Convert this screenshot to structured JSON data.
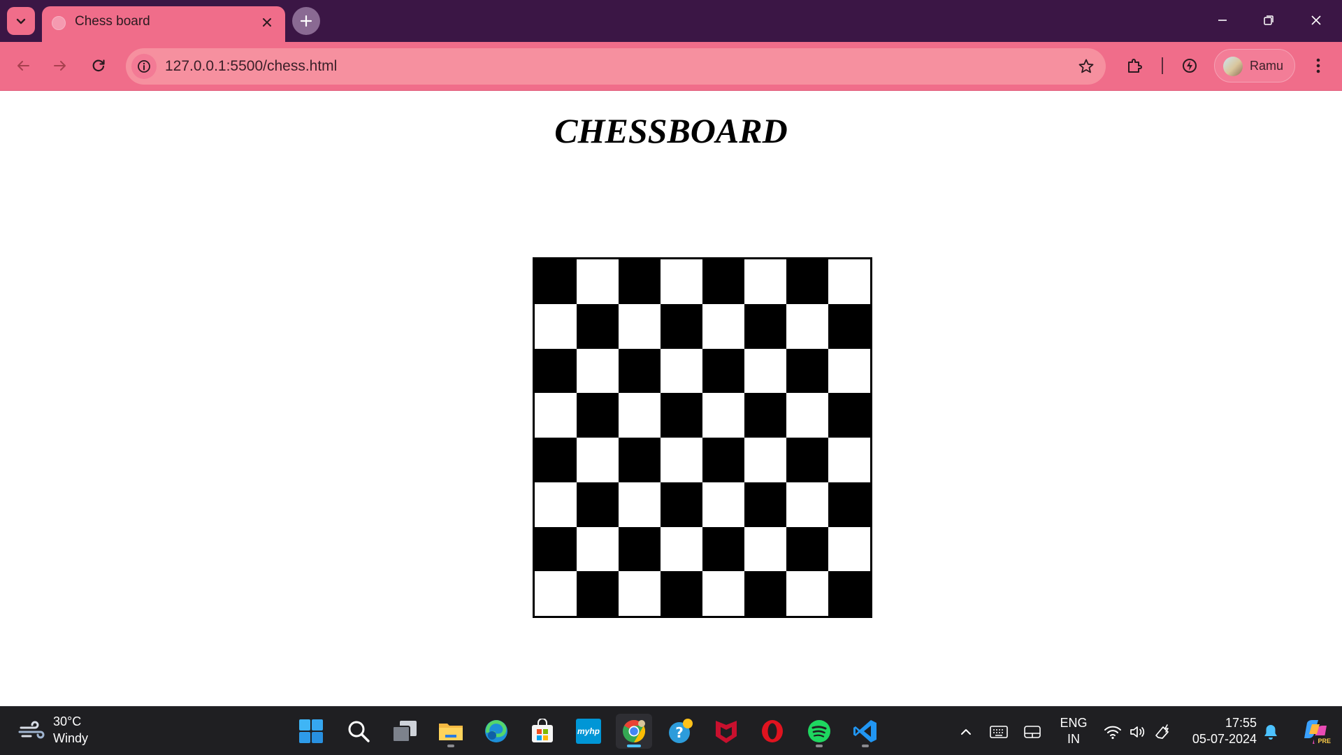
{
  "browser": {
    "tab_title": "Chess board",
    "url": "127.0.0.1:5500/chess.html",
    "profile_name": "Ramu",
    "accent_color": "#f06d8a",
    "frame_color": "#3b1645"
  },
  "page": {
    "title": "CHESSBOARD",
    "board": {
      "rows": 8,
      "cols": 8,
      "top_left_color": "black",
      "dark_color": "#000000",
      "light_color": "#ffffff"
    }
  },
  "taskbar": {
    "weather_temp": "30°C",
    "weather_desc": "Windy",
    "pinned_apps": [
      "start-icon",
      "search-icon",
      "task-view-icon",
      "file-explorer-icon",
      "edge-icon",
      "microsoft-store-icon",
      "myhp-icon",
      "chrome-icon",
      "help-icon",
      "mcafee-icon",
      "opera-icon",
      "spotify-icon",
      "vscode-icon"
    ],
    "myhp_label": "myhp",
    "lang_line1": "ENG",
    "lang_line2": "IN",
    "time": "17:55",
    "date": "05-07-2024",
    "copilot_badge": "PRE"
  }
}
